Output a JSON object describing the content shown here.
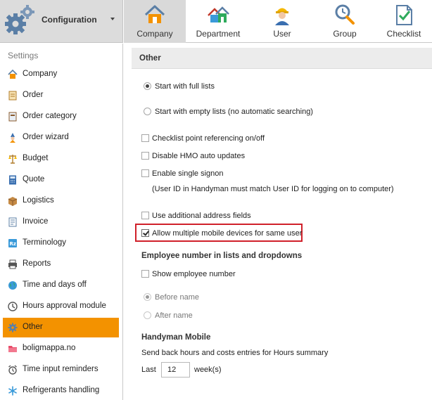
{
  "header": {
    "title": "Configuration",
    "icon": "gear-icon"
  },
  "tabs": [
    {
      "label": "Company",
      "icon": "house-icon",
      "active": true
    },
    {
      "label": "Department",
      "icon": "houses-icon",
      "active": false
    },
    {
      "label": "User",
      "icon": "worker-icon",
      "active": false
    },
    {
      "label": "Group",
      "icon": "magnifier-clock-icon",
      "active": false
    },
    {
      "label": "Checklist",
      "icon": "checklist-icon",
      "active": false
    }
  ],
  "sidebar": {
    "heading": "Settings",
    "items": [
      {
        "label": "Company",
        "icon": "house-icon"
      },
      {
        "label": "Order",
        "icon": "order-icon"
      },
      {
        "label": "Order category",
        "icon": "category-icon"
      },
      {
        "label": "Order wizard",
        "icon": "wizard-icon"
      },
      {
        "label": "Budget",
        "icon": "scales-icon"
      },
      {
        "label": "Quote",
        "icon": "calculator-icon"
      },
      {
        "label": "Logistics",
        "icon": "box-icon"
      },
      {
        "label": "Invoice",
        "icon": "invoice-icon"
      },
      {
        "label": "Terminology",
        "icon": "terminology-icon"
      },
      {
        "label": "Reports",
        "icon": "printer-icon"
      },
      {
        "label": "Time and days off",
        "icon": "globe-icon"
      },
      {
        "label": "Hours approval module",
        "icon": "clock-icon"
      },
      {
        "label": "Other",
        "icon": "gear-icon",
        "active": true
      },
      {
        "label": "boligmappa.no",
        "icon": "folder-icon"
      },
      {
        "label": "Time input reminders",
        "icon": "alarm-icon"
      },
      {
        "label": "Refrigerants handling",
        "icon": "snowflake-icon"
      }
    ]
  },
  "main": {
    "section_title": "Other",
    "radio_full": "Start with full lists",
    "radio_empty": "Start with empty lists (no automatic searching)",
    "check_referencing": "Checklist point referencing on/off",
    "check_hmo": "Disable HMO auto updates",
    "check_signon": "Enable single signon",
    "signon_note": "(User ID in Handyman must match User ID for logging on to computer)",
    "check_address": "Use additional address fields",
    "check_multiple": "Allow multiple mobile devices for same user",
    "employee_heading": "Employee number in lists and dropdowns",
    "check_show_employee": "Show employee number",
    "radio_before": "Before name",
    "radio_after": "After name",
    "mobile_heading": "Handyman Mobile",
    "mobile_desc": "Send back hours and costs entries for Hours summary",
    "last_label": "Last",
    "last_value": "12",
    "weeks_label": "week(s)"
  },
  "colors": {
    "accent": "#f39200",
    "highlight": "#d0202a"
  }
}
